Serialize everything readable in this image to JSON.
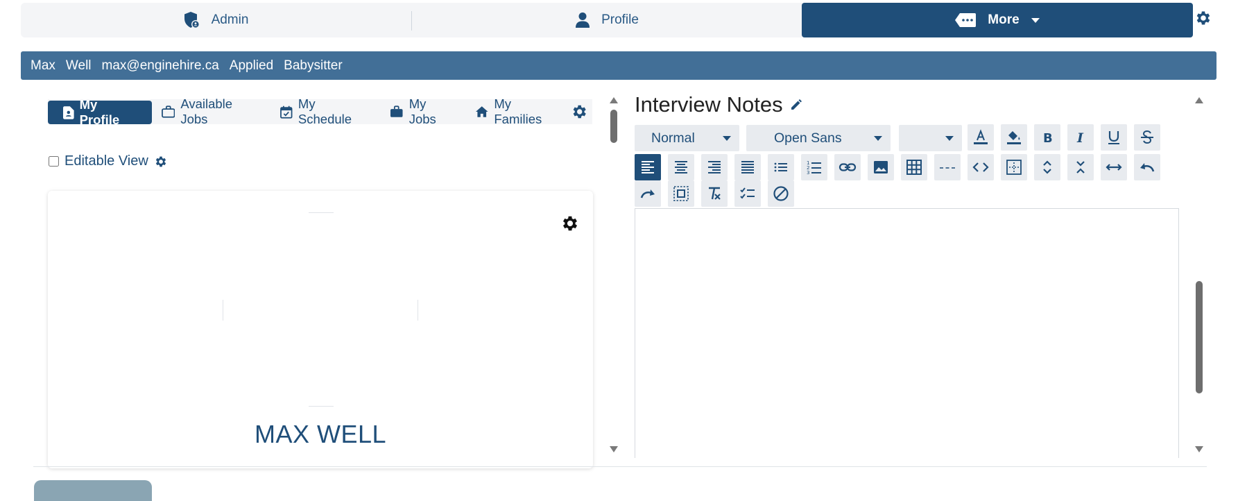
{
  "topnav": {
    "admin_label": "Admin",
    "profile_label": "Profile",
    "more_label": "More"
  },
  "infobar": {
    "first_name": "Max",
    "last_name": "Well",
    "email": "max@enginehire.ca",
    "status": "Applied",
    "position": "Babysitter"
  },
  "left_tabs": [
    {
      "label": "My Profile",
      "icon": "profile-doc-icon",
      "active": true
    },
    {
      "label": "Available Jobs",
      "icon": "briefcase-outline-icon"
    },
    {
      "label": "My Schedule",
      "icon": "calendar-check-icon"
    },
    {
      "label": "My Jobs",
      "icon": "briefcase-icon"
    },
    {
      "label": "My Families",
      "icon": "home-icon"
    }
  ],
  "editable_view": {
    "label": "Editable View",
    "checked": false
  },
  "profile_card": {
    "name": "MAX WELL"
  },
  "notes": {
    "title": "Interview Notes",
    "style_select": "Normal",
    "font_select": "Open Sans",
    "size_select": ""
  },
  "colors": {
    "primary": "#1f4e79",
    "infobar": "#426f97",
    "toolbar_bg": "#e8ebef"
  }
}
